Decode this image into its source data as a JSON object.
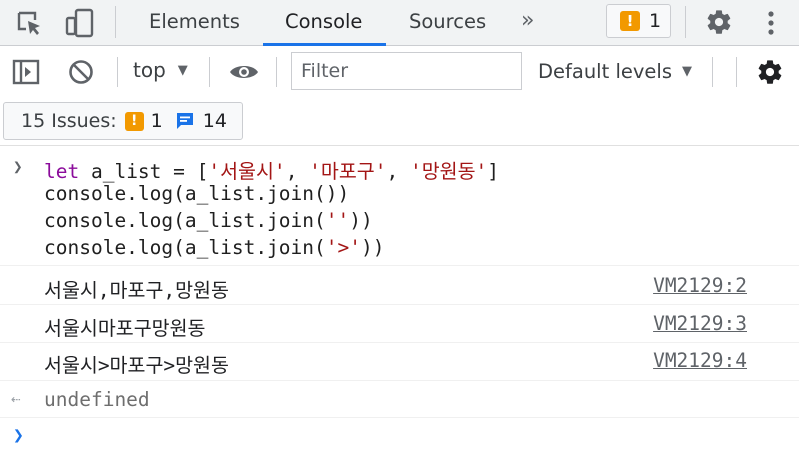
{
  "devtools": {
    "tabs": [
      "Elements",
      "Console",
      "Sources"
    ],
    "active_tab": "Console",
    "more_tabs_symbol": "»",
    "issue_badge_count": "1",
    "accent_color": "#1a73e8",
    "warning_color": "#f29900"
  },
  "toolbar": {
    "context_value": "top",
    "filter_placeholder": "Filter",
    "levels_label": "Default levels"
  },
  "issues": {
    "label": "15 Issues:",
    "warning_count": "1",
    "info_count": "14"
  },
  "console": {
    "input_lines": [
      [
        "let",
        " a_list = [",
        "'서울시'",
        ", ",
        "'마포구'",
        ", ",
        "'망원동'",
        "]"
      ],
      [
        "",
        "console.log(a_list.join())",
        "",
        "",
        "",
        "",
        "",
        ""
      ],
      [
        "",
        "console.log(a_list.join(",
        "''",
        "))",
        "",
        "",
        "",
        ""
      ],
      [
        "",
        "console.log(a_list.join(",
        "'>'",
        "))",
        "",
        "",
        "",
        ""
      ]
    ],
    "outputs": [
      {
        "text": "서울시,마포구,망원동",
        "source": "VM2129:2"
      },
      {
        "text": "서울시마포구망원동",
        "source": "VM2129:3"
      },
      {
        "text": "서울시>마포구>망원동",
        "source": "VM2129:4"
      }
    ],
    "return_value": "undefined"
  }
}
